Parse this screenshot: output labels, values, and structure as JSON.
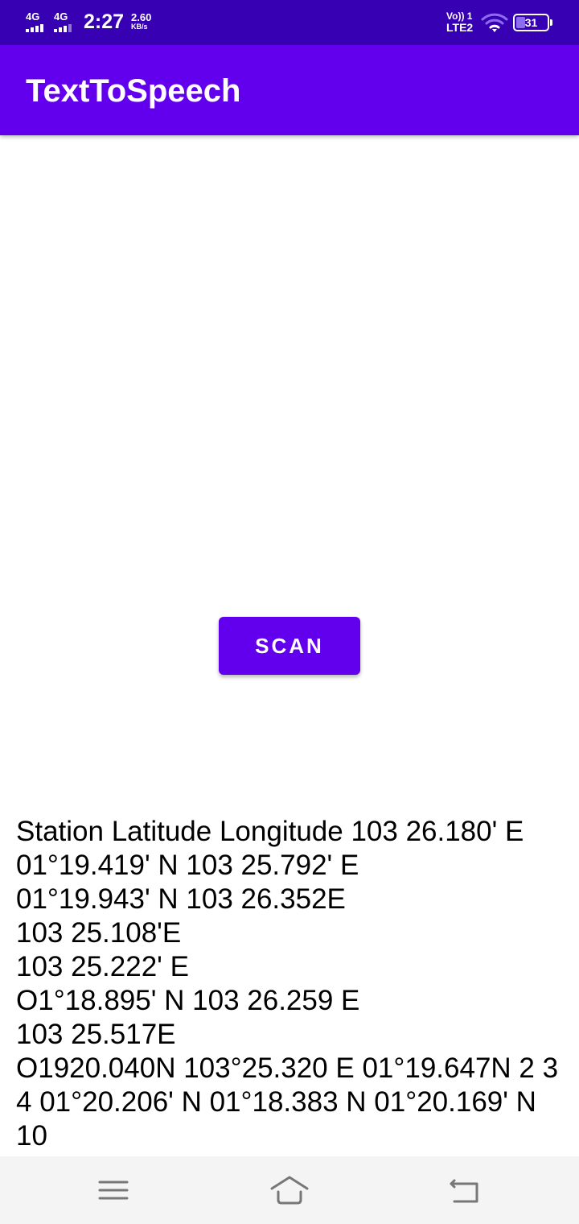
{
  "status_bar": {
    "sim1_network": "4G",
    "sim2_network": "4G",
    "time": "2:27",
    "net_speed_value": "2.60",
    "net_speed_unit": "KB/s",
    "volte_label": "Vo)) 1",
    "lte_label": "LTE2",
    "battery_level": "31",
    "battery_fraction": 0.31
  },
  "app_bar": {
    "title": "TextToSpeech"
  },
  "scan_button": {
    "label": "SCAN"
  },
  "result_text": {
    "lines": [
      "Station Latitude Longitude 103 26.180' E",
      "01°19.419' N 103 25.792' E",
      "01°19.943' N 103 26.352E",
      "103 25.108'E",
      "103 25.222' E",
      "O1°18.895' N 103 26.259 E",
      "103 25.517E",
      "O1920.040N 103°25.320 E 01°19.647N 2 3",
      "4 01°20.206' N 01°18.383 N 01°20.169' N",
      "10"
    ]
  },
  "colors": {
    "status_bar": "#3700b3",
    "primary": "#6200ee",
    "nav_bar": "#f4f4f4"
  },
  "nav_bar": {
    "icons": [
      "menu-icon",
      "home-icon",
      "back-icon"
    ]
  }
}
